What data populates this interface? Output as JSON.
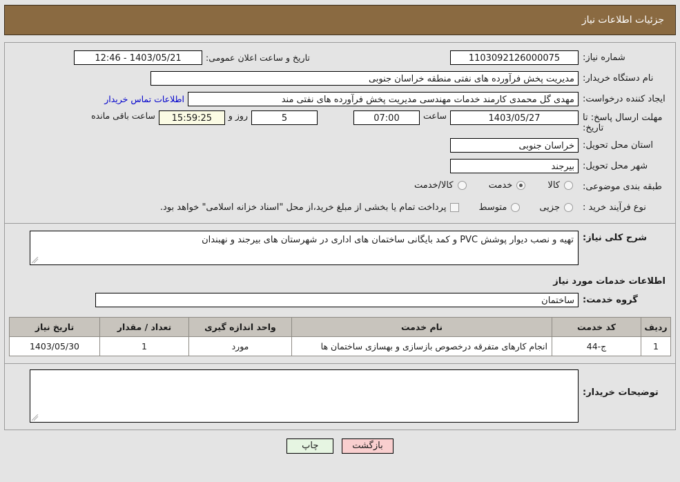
{
  "header": {
    "title": "جزئیات اطلاعات نیاز"
  },
  "fields": {
    "need_no_label": "شماره نیاز:",
    "need_no_value": "1103092126000075",
    "announce_label": "تاریخ و ساعت اعلان عمومی:",
    "announce_value": "1403/05/21 - 12:46",
    "buyer_org_label": "نام دستگاه خریدار:",
    "buyer_org_value": "مدیریت پخش فرآورده های نفتی منطقه خراسان جنوبی",
    "creator_label": "ایجاد کننده درخواست:",
    "creator_value": "مهدی گل محمدی کارمند خدمات مهندسی مدیریت پخش فرآورده های نفتی مند",
    "contact_link": "اطلاعات تماس خریدار",
    "deadline_label_line1": "مهلت ارسال پاسخ: تا",
    "deadline_label_line2": "تاریخ:",
    "deadline_date": "1403/05/27",
    "deadline_time_label": "ساعت",
    "deadline_time": "07:00",
    "deadline_days": "5",
    "deadline_days_label": "روز و",
    "deadline_countdown": "15:59:25",
    "deadline_remaining_label": "ساعت باقی مانده",
    "province_label": "استان محل تحویل:",
    "province_value": "خراسان جنوبی",
    "city_label": "شهر محل تحویل:",
    "city_value": "بیرجند",
    "category_label": "طبقه بندی موضوعی:",
    "process_label": "نوع فرآیند خرید :"
  },
  "category_options": [
    {
      "label": "کالا",
      "selected": false
    },
    {
      "label": "خدمت",
      "selected": true
    },
    {
      "label": "کالا/خدمت",
      "selected": false
    }
  ],
  "process_options": [
    {
      "label": "جزیی",
      "selected": false
    },
    {
      "label": "متوسط",
      "selected": false
    }
  ],
  "process_checkbox": {
    "label": "پرداخت تمام یا بخشی از مبلغ خرید،از محل \"اسناد خزانه اسلامی\" خواهد بود.",
    "checked": false
  },
  "need_desc": {
    "label": "شرح کلی نیاز:",
    "value": "تهیه و نصب دیوار پوشش PVC و کمد بایگانی ساختمان های اداری در شهرستان های بیرجند و نهبندان"
  },
  "services_section": {
    "heading": "اطلاعات خدمات مورد نیاز",
    "group_label": "گروه خدمت:",
    "group_value": "ساختمان"
  },
  "table": {
    "columns": [
      "ردیف",
      "کد خدمت",
      "نام خدمت",
      "واحد اندازه گیری",
      "تعداد / مقدار",
      "تاریخ نیاز"
    ],
    "rows": [
      {
        "row_no": "1",
        "service_code": "ج-44",
        "service_name": "انجام کارهای متفرقه درخصوص بازسازی و بهسازی ساختمان ها",
        "unit": "مورد",
        "quantity": "1",
        "need_date": "1403/05/30"
      }
    ]
  },
  "buyer_notes": {
    "label": "توضیحات خریدار:",
    "value": ""
  },
  "footer": {
    "back_label": "بازگشت",
    "print_label": "چاپ"
  },
  "colors": {
    "header_bg": "#8a6a41",
    "page_bg": "#e4e4e4",
    "table_header_bg": "#c8c4bd",
    "link": "#0000cc",
    "back_btn": "#f9cfcf",
    "print_btn": "#e6f5e2",
    "countdown_bg": "#fbfbe4"
  }
}
